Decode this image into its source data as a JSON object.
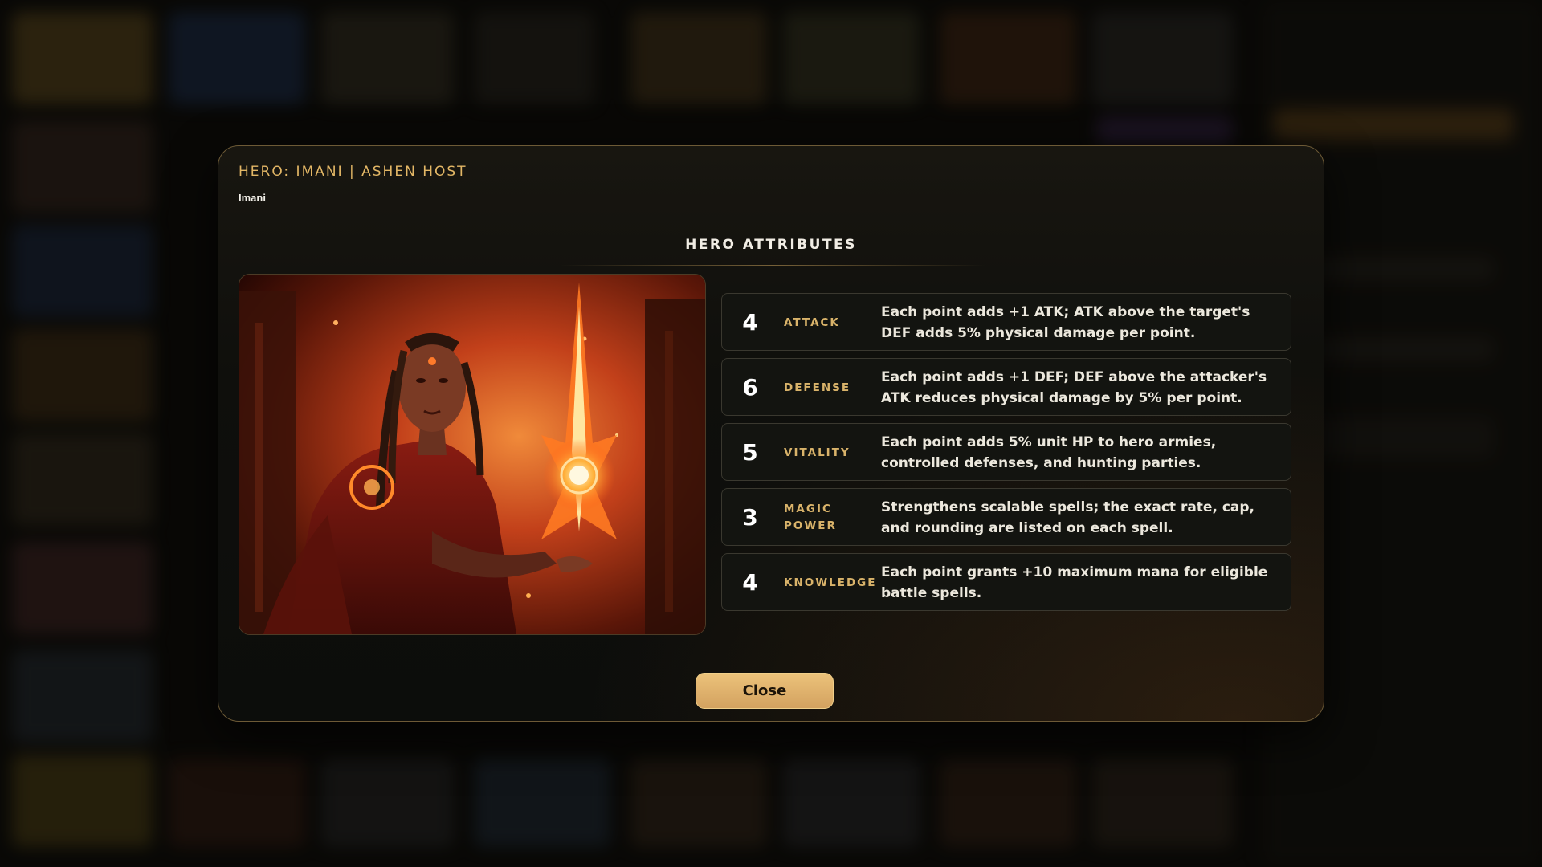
{
  "modal": {
    "title": "HERO: IMANI | ASHEN HOST",
    "hero_name": "Imani",
    "section_title": "HERO ATTRIBUTES",
    "close_label": "Close"
  },
  "portrait": {
    "icon": "hero-portrait-fire-sorceress"
  },
  "attributes": [
    {
      "value": "4",
      "name": "ATTACK",
      "description": "Each point adds +1 ATK; ATK above the target's DEF adds 5% physical damage per point."
    },
    {
      "value": "6",
      "name": "DEFENSE",
      "description": "Each point adds +1 DEF; DEF above the attacker's ATK reduces physical damage by 5% per point."
    },
    {
      "value": "5",
      "name": "VITALITY",
      "description": "Each point adds 5% unit HP to hero armies, controlled defenses, and hunting parties."
    },
    {
      "value": "3",
      "name": "MAGIC POWER",
      "description": "Strengthens scalable spells; the exact rate, cap, and rounding are listed on each spell."
    },
    {
      "value": "4",
      "name": "KNOWLEDGE",
      "description": "Each point grants +10 maximum mana for eligible battle spells."
    }
  ],
  "colors": {
    "accent_gold": "#e3b766",
    "button_gold": "#dcae69",
    "modal_border": "#6d5a36"
  }
}
